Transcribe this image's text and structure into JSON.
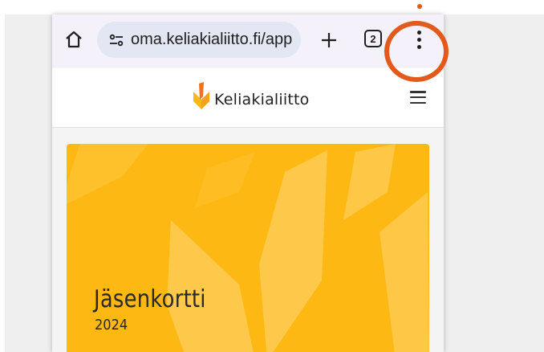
{
  "browser": {
    "url": "oma.keliakialiitto.fi/app",
    "tab_count": "2",
    "icons": {
      "home": "home-icon",
      "site_settings": "tune-icon",
      "new_tab": "plus-icon",
      "tabs": "tab-switcher-icon",
      "menu": "more-vert-icon"
    }
  },
  "site": {
    "brand_name": "Keliakialiitto"
  },
  "card": {
    "title": "Jäsenkortti",
    "year": "2024"
  },
  "colors": {
    "brand_yellow": "#fdb813",
    "brand_orange": "#f36f21",
    "highlight": "#e25a1c",
    "toolbar_bg": "#f4f1fa",
    "url_pill_bg": "#e3e6f3"
  }
}
